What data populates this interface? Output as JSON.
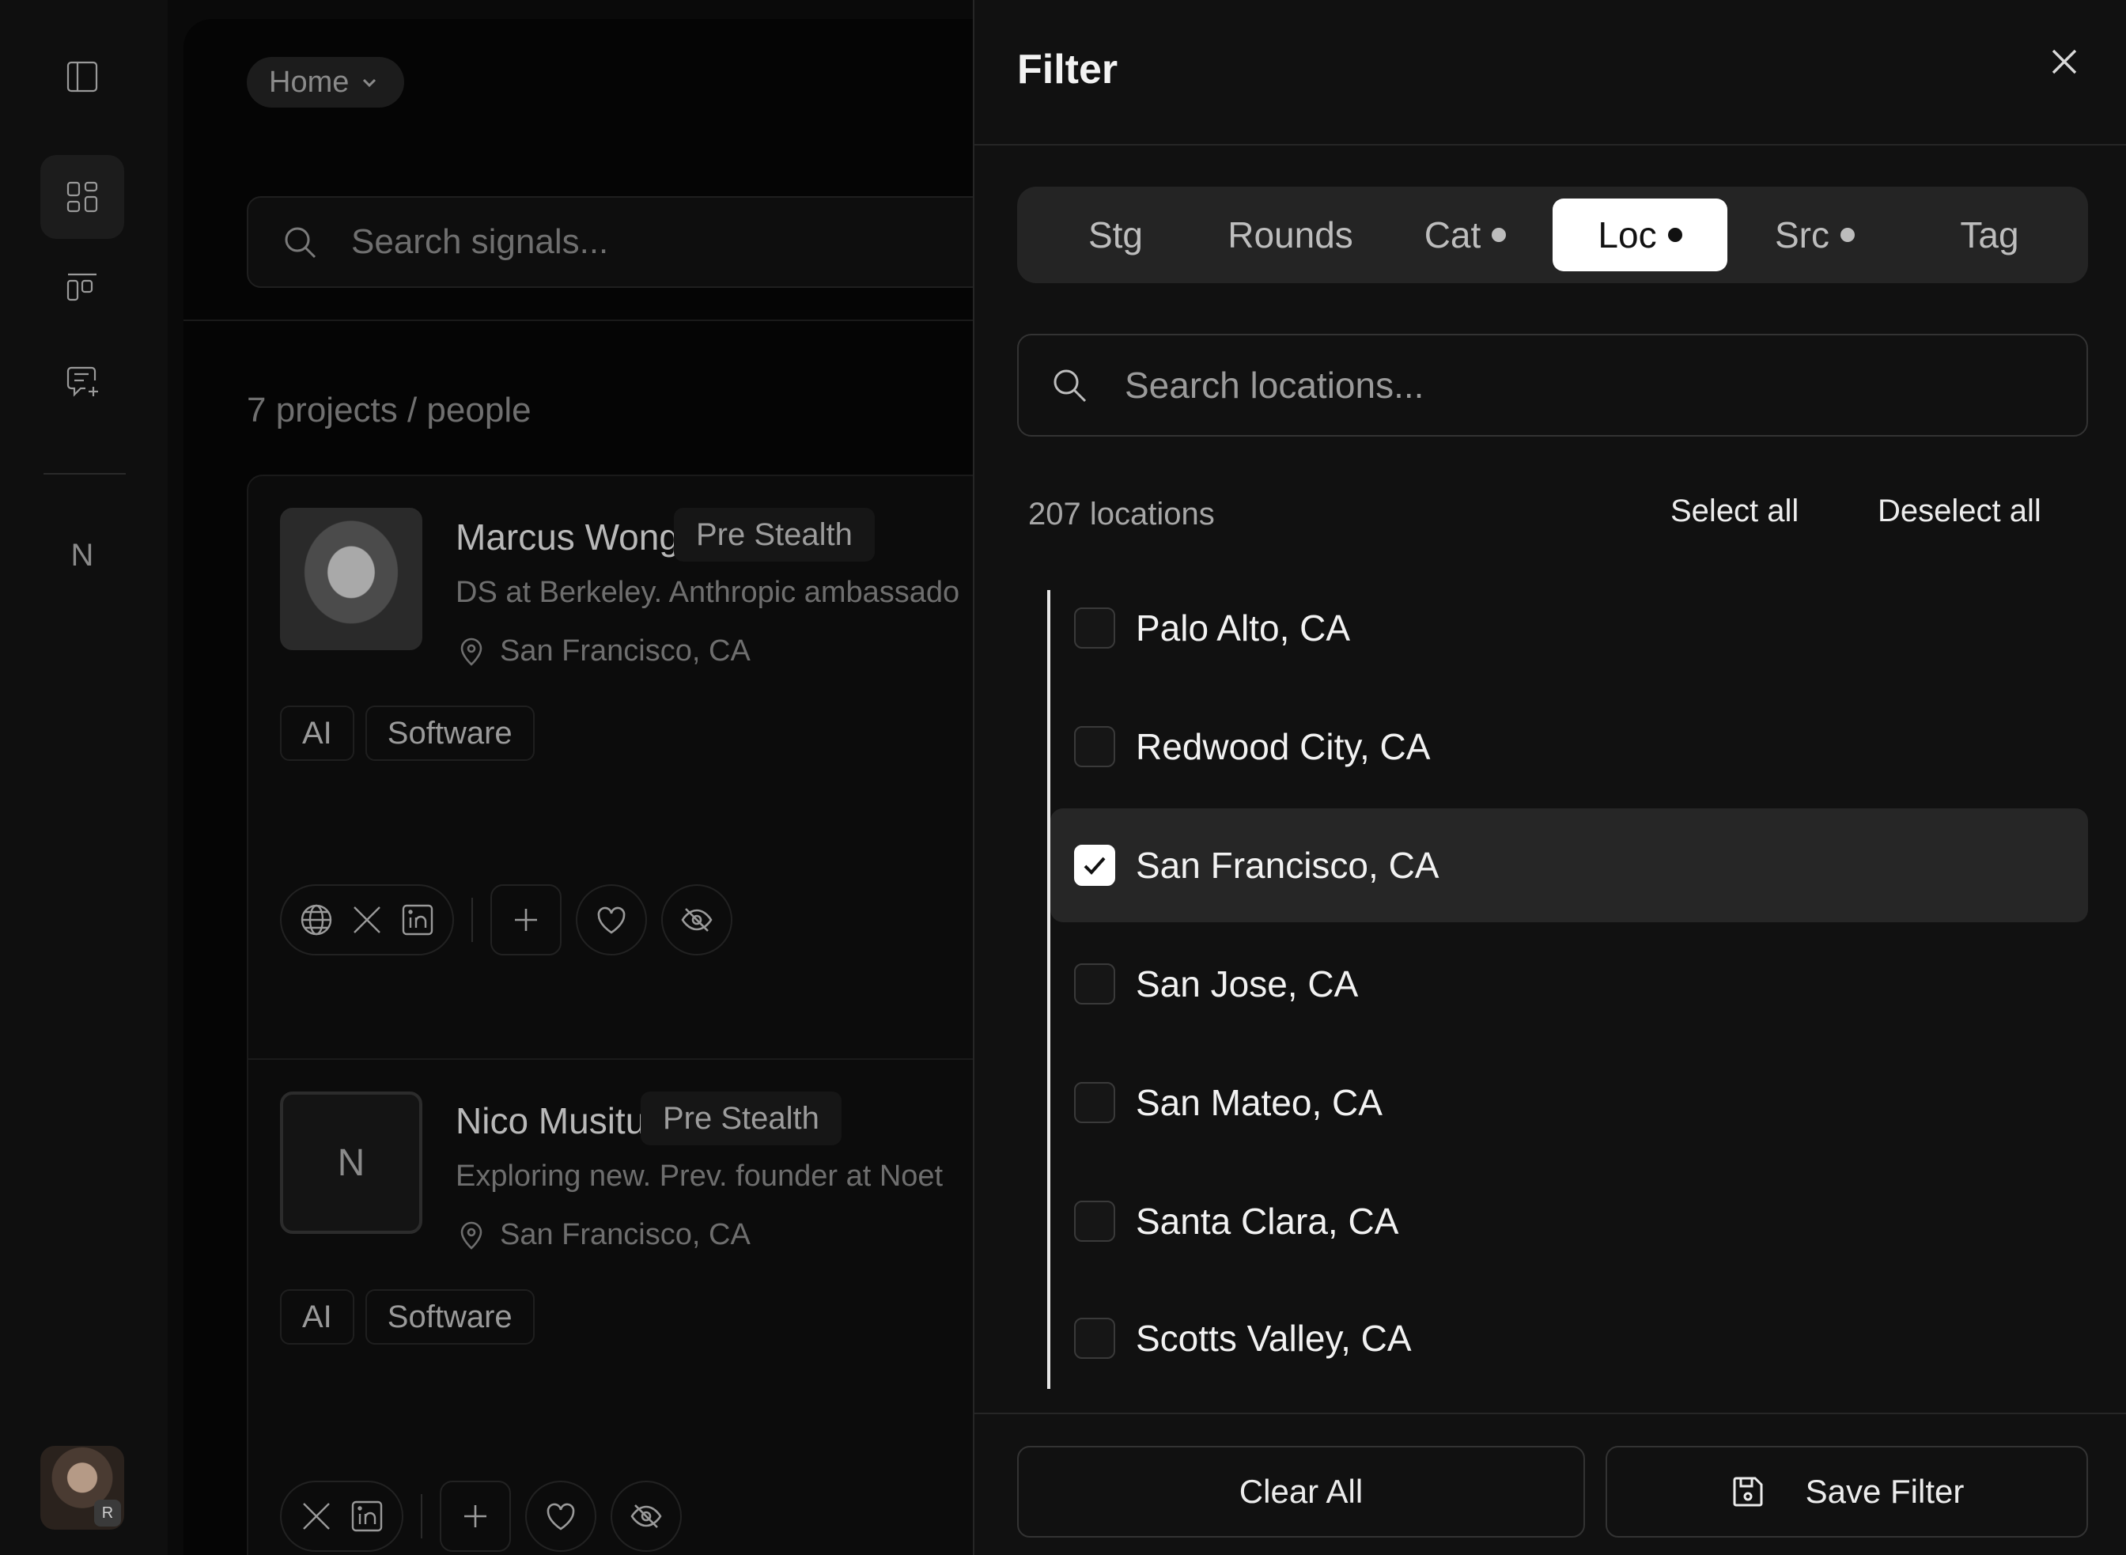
{
  "rail": {
    "icons": [
      "sidebar-toggle-icon",
      "dashboard-icon",
      "kanban-icon",
      "message-add-icon"
    ],
    "workspace_letter": "N"
  },
  "main": {
    "home_label": "Home",
    "search_placeholder": "Search signals...",
    "count_text": "7 projects / people",
    "cards": [
      {
        "name": "Marcus Wong",
        "stage": "Pre Stealth",
        "description": "DS at Berkeley. Anthropic ambassado",
        "location": "San Francisco, CA",
        "tags": [
          "AI",
          "Software"
        ],
        "socials": [
          "globe-icon",
          "x-icon",
          "linkedin-icon"
        ]
      },
      {
        "name": "Nico Musitu",
        "initial": "N",
        "stage": "Pre Stealth",
        "description": "Exploring new. Prev. founder at Noet",
        "location": "San Francisco, CA",
        "tags": [
          "AI",
          "Software"
        ],
        "socials": [
          "x-icon",
          "linkedin-icon"
        ]
      }
    ]
  },
  "filter": {
    "title": "Filter",
    "tabs": [
      {
        "label": "Stg",
        "dot": false,
        "active": false
      },
      {
        "label": "Rounds",
        "dot": false,
        "active": false
      },
      {
        "label": "Cat",
        "dot": true,
        "active": false
      },
      {
        "label": "Loc",
        "dot": true,
        "active": true
      },
      {
        "label": "Src",
        "dot": true,
        "active": false
      },
      {
        "label": "Tag",
        "dot": false,
        "active": false
      }
    ],
    "search_placeholder": "Search locations...",
    "count_text": "207 locations",
    "select_all": "Select all",
    "deselect_all": "Deselect all",
    "locations": [
      {
        "label": "Palo Alto, CA",
        "checked": false
      },
      {
        "label": "Redwood City, CA",
        "checked": false
      },
      {
        "label": "San Francisco, CA",
        "checked": true
      },
      {
        "label": "San Jose, CA",
        "checked": false
      },
      {
        "label": "San Mateo, CA",
        "checked": false
      },
      {
        "label": "Santa Clara, CA",
        "checked": false
      },
      {
        "label": "Scotts Valley, CA",
        "checked": false
      }
    ],
    "clear_all": "Clear All",
    "save_filter": "Save Filter"
  }
}
